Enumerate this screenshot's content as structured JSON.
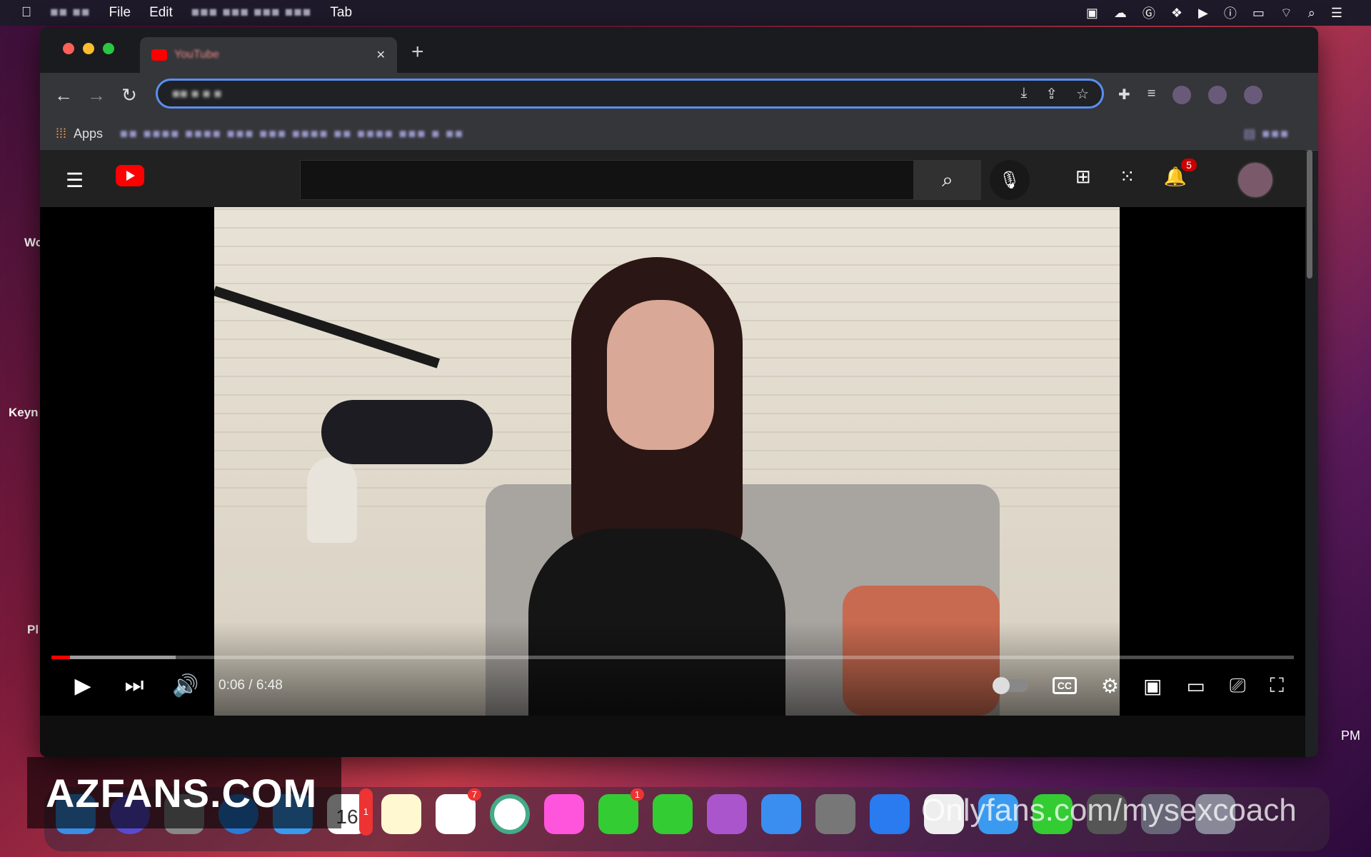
{
  "menubar": {
    "items": [
      "File",
      "Edit",
      "Tab"
    ]
  },
  "desktop": {
    "labels": [
      "Keyn",
      "Wo",
      "Pl",
      "PM"
    ]
  },
  "browser": {
    "tab_title": "YouTube",
    "bookmarks_apps_label": "Apps"
  },
  "youtube": {
    "notification_count": "5"
  },
  "player": {
    "current_time": "0:06",
    "duration": "6:48",
    "time_display": "0:06 / 6:48",
    "progress_fraction": 0.015,
    "buffered_fraction": 0.1,
    "cc_label": "CC"
  },
  "dock": {
    "calendar_date": "16",
    "calendar_badge": "1",
    "reminders_badge": "7",
    "messages_badge": "1"
  },
  "watermark": {
    "text": "AZFANS.COM",
    "text2": "Onlyfans.com/mysexcoach"
  },
  "colors": {
    "youtube_red": "#ff0000",
    "omnibox_focus": "#5a8ff0",
    "browser_dark": "#35363a"
  }
}
